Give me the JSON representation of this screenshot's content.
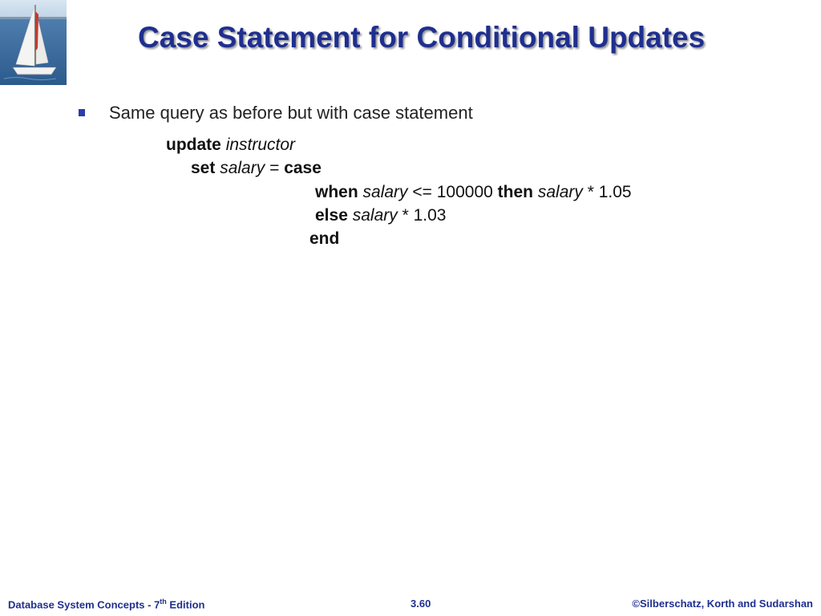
{
  "header": {
    "title": "Case Statement for Conditional Updates"
  },
  "bullet": {
    "text": "Same query as before but with case statement"
  },
  "code": {
    "line1": {
      "kw": "update",
      "id": "instructor"
    },
    "line2": {
      "kw1": "set",
      "id": "salary",
      "op": "=",
      "kw2": "case"
    },
    "line3": {
      "kw1": "when",
      "id1": "salary",
      "cond": "<= 100000",
      "kw2": "then",
      "id2": "salary",
      "expr": "* 1.05"
    },
    "line4": {
      "kw": "else",
      "id": "salary",
      "expr": "* 1.03"
    },
    "line5": {
      "kw": "end"
    }
  },
  "footer": {
    "left_main": "Database System Concepts - 7",
    "left_sup": "th",
    "left_tail": " Edition",
    "center": "3.60",
    "right": "©Silberschatz, Korth and Sudarshan"
  }
}
